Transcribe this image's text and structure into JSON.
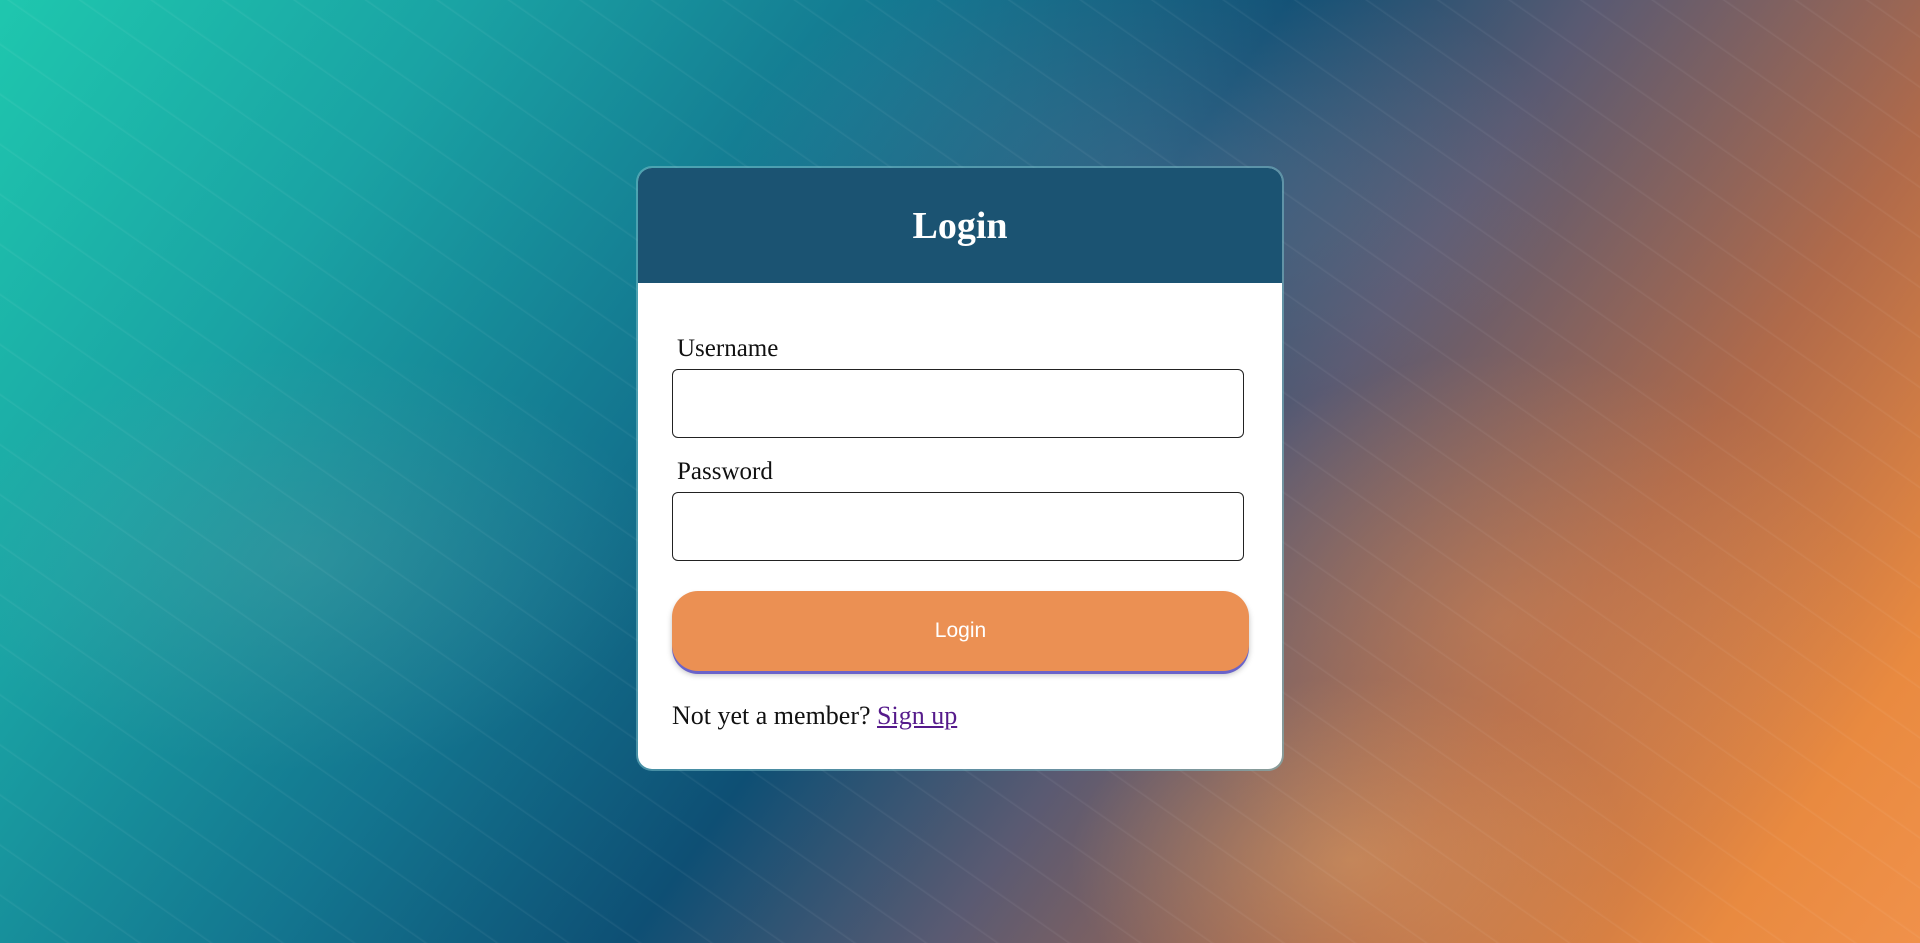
{
  "login_card": {
    "title": "Login",
    "username_label": "Username",
    "username_value": "",
    "password_label": "Password",
    "password_value": "",
    "submit_label": "Login",
    "signup_prompt": "Not yet a member?",
    "signup_link": "Sign up"
  },
  "colors": {
    "header": "#1b5372",
    "button": "#eb9053",
    "link": "#551a8b",
    "background_left": "#1fc7ae",
    "background_right": "#f0914a"
  }
}
